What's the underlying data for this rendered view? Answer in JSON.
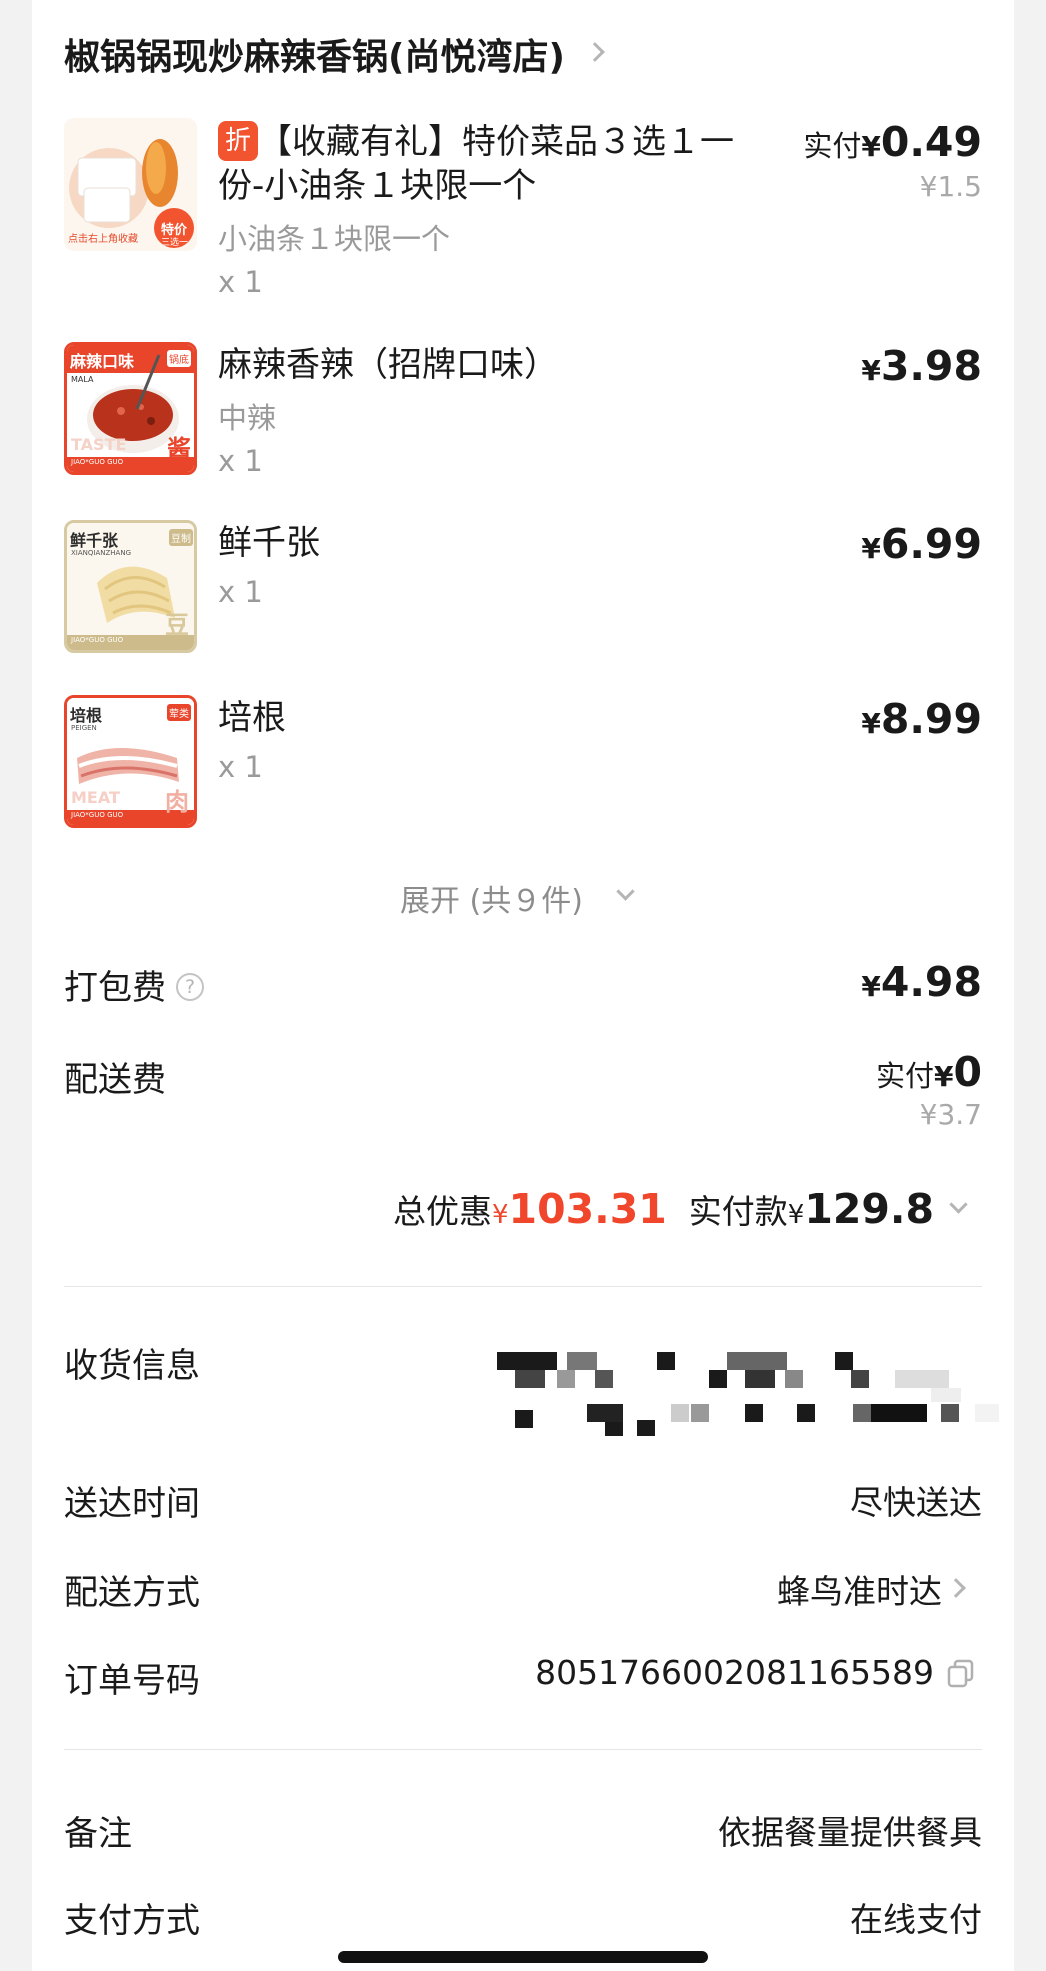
{
  "shop": {
    "name": "椒锅锅现炒麻辣香锅(尚悦湾店)"
  },
  "items": [
    {
      "badge": "折",
      "name_line1": "【收藏有礼】特价菜品３选１一",
      "name_line2": "份-小油条１块限一个",
      "spec": "小油条１块限一个",
      "qty": "x 1",
      "price_label": "实付",
      "currency": "¥",
      "price": "0.49",
      "original_price": "¥1.5",
      "thumb_text": [
        "点击右上角收藏",
        "特价",
        "三选一"
      ]
    },
    {
      "name_line1": "麻辣香辣（招牌口味）",
      "spec": "中辣",
      "qty": "x 1",
      "currency": "¥",
      "price": "3.98",
      "thumb_text": [
        "麻辣口味",
        "锅底",
        "MALA",
        "TASTE",
        "酱",
        "JIAO*GUO GUO"
      ]
    },
    {
      "name_line1": "鲜千张",
      "qty": "x 1",
      "currency": "¥",
      "price": "6.99",
      "thumb_text": [
        "鲜千张",
        "豆制",
        "XIANQIANZHANG",
        "豆",
        "JIAO*GUO GUO"
      ]
    },
    {
      "name_line1": "培根",
      "qty": "x 1",
      "currency": "¥",
      "price": "8.99",
      "thumb_text": [
        "培根",
        "荤类",
        "PEIGEN",
        "MEAT",
        "肉",
        "JIAO*GUO GUO"
      ]
    }
  ],
  "expand": {
    "label": "展开 (共９件)"
  },
  "fees": {
    "packing_label": "打包费",
    "packing_help": "?",
    "packing_currency": "¥",
    "packing_value": "4.98",
    "delivery_label": "配送费",
    "delivery_paid_label": "实付",
    "delivery_currency": "¥",
    "delivery_value": "0",
    "delivery_original": "¥3.7"
  },
  "summary": {
    "discount_label": "总优惠",
    "discount_currency": "¥",
    "discount_value": "103.31",
    "paid_label": "实付款",
    "paid_currency": "¥",
    "paid_value": "129.8"
  },
  "info": {
    "receiver_label": "收货信息",
    "time_label": "送达时间",
    "time_value": "尽快送达",
    "method_label": "配送方式",
    "method_value": "蜂鸟准时达",
    "order_label": "订单号码",
    "order_value": "8051766002081165589",
    "note_label": "备注",
    "note_value": "依据餐量提供餐具",
    "pay_label": "支付方式",
    "pay_value": "在线支付"
  },
  "colors": {
    "accent_red": "#f0462b",
    "badge_red": "#f25430",
    "muted": "#9a9a9a"
  }
}
